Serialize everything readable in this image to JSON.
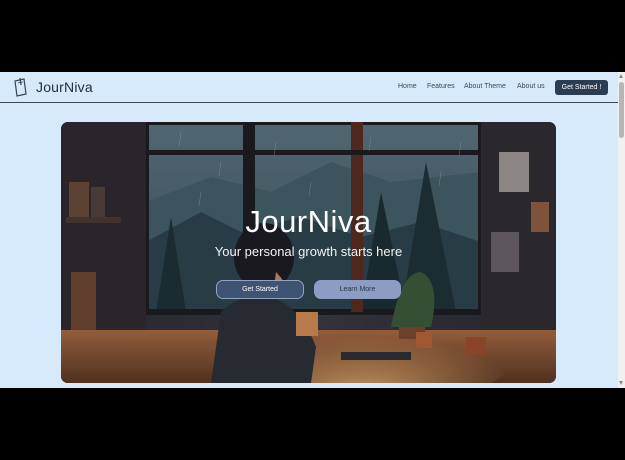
{
  "navbar": {
    "brand": "JourNiva",
    "logo_icon": "journal-icon",
    "links": [
      "Home",
      "Features",
      "About Theme",
      "About us"
    ],
    "cta_label": "Get Started !"
  },
  "hero": {
    "title": "JourNiva",
    "subtitle": "Your personal growth starts here",
    "primary_button": "Get Started",
    "secondary_button": "Learn More",
    "background": "illustration of a person writing at a desk by a rainy window"
  },
  "colors": {
    "page_background": "#d6eafb",
    "nav_text": "#3b4656",
    "cta_background": "#2b3d52",
    "primary_button": "#3f5373",
    "secondary_button": "#8d9cc2"
  }
}
